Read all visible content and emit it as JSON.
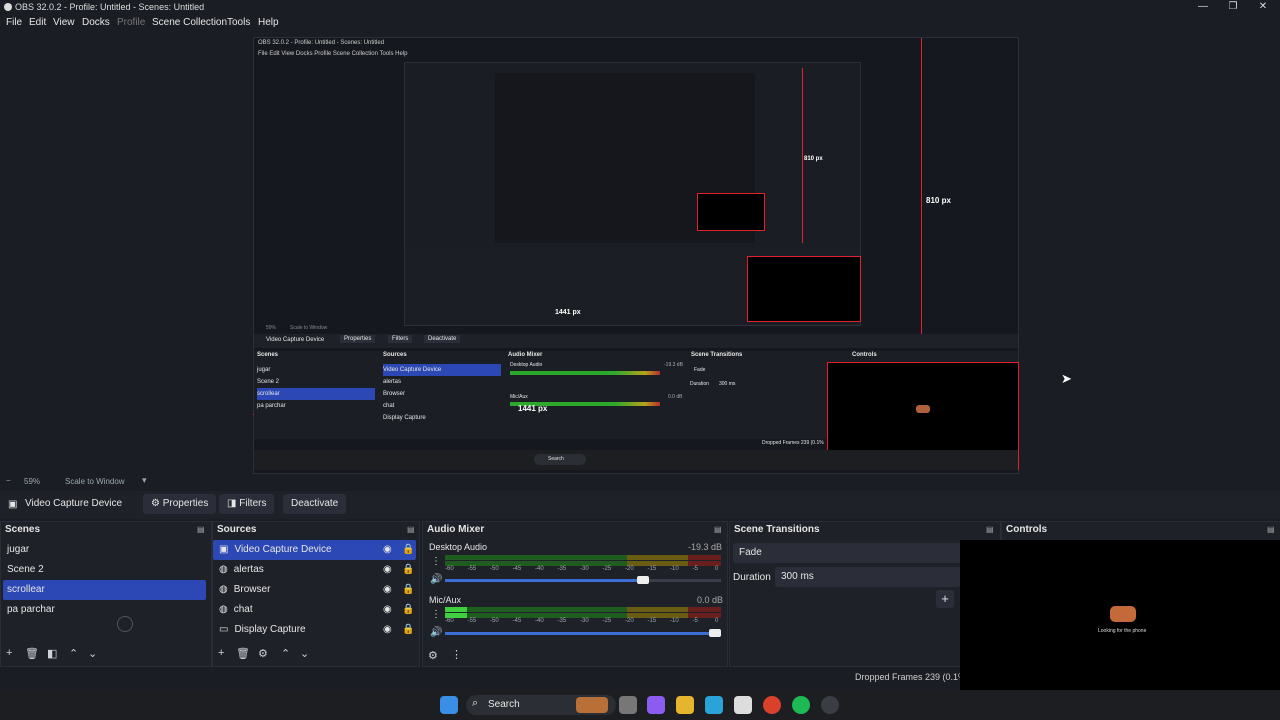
{
  "window": {
    "title": "OBS 32.0.2 - Profile: Untitled - Scenes: Untitled",
    "minimize": "—",
    "maximize": "❐",
    "close": "✕"
  },
  "menu": [
    "File",
    "Edit",
    "View",
    "Docks",
    "Profile",
    "Scene Collection",
    "Tools",
    "Help"
  ],
  "nested": {
    "title": "OBS 32.0.2 - Profile: Untitled - Scenes: Untitled",
    "menu": "File  Edit  View  Docks  Profile  Scene Collection  Tools  Help",
    "measure_810": "810 px",
    "measure_810_small": "810 px",
    "measure_1441": "1441 px",
    "zoom": "59%",
    "zoom_mode": "Scale to Window",
    "source_name": "Video Capture Device",
    "btn_properties": "Properties",
    "btn_filters": "Filters",
    "btn_deactivate": "Deactivate",
    "dock_scenes": "Scenes",
    "dock_sources": "Sources",
    "dock_mixer": "Audio Mixer",
    "dock_transitions": "Scene Transitions",
    "dock_controls": "Controls",
    "scenes": [
      "jugar",
      "Scene 2",
      "scrollear",
      "pa parchar"
    ],
    "sources": [
      "Video Capture Device",
      "alertas",
      "Browser",
      "chat",
      "Display Capture"
    ],
    "desktop_audio": "Desktop Audio",
    "desktop_db": "-19.3 dB",
    "mic": "Mic/Aux",
    "mic_db": "0.0 dB",
    "fade": "Fade",
    "duration": "Duration",
    "duration_val": "300 ms",
    "dropped": "Dropped Frames 239 (0.1%",
    "search": "Search"
  },
  "zoombar": {
    "minus": "−",
    "zoom": "59%",
    "mode": "Scale to Window"
  },
  "source_toolbar": {
    "source_name": "Video Capture Device",
    "properties": "Properties",
    "filters": "Filters",
    "deactivate": "Deactivate"
  },
  "scenes": {
    "title": "Scenes",
    "items": [
      "jugar",
      "Scene 2",
      "scrollear",
      "pa parchar"
    ],
    "selected": 2
  },
  "sources": {
    "title": "Sources",
    "items": [
      {
        "name": "Video Capture Device",
        "icon": "camera-icon"
      },
      {
        "name": "alertas",
        "icon": "globe-icon"
      },
      {
        "name": "Browser",
        "icon": "globe-icon"
      },
      {
        "name": "chat",
        "icon": "globe-icon"
      },
      {
        "name": "Display Capture",
        "icon": "monitor-icon"
      }
    ],
    "selected": 0
  },
  "mixer": {
    "title": "Audio Mixer",
    "tracks": [
      {
        "name": "Desktop Audio",
        "db": "-19.3 dB",
        "volume": 0.74
      },
      {
        "name": "Mic/Aux",
        "db": "0.0 dB",
        "volume": 1.0
      }
    ],
    "scale": [
      "-60",
      "-55",
      "-50",
      "-45",
      "-40",
      "-35",
      "-30",
      "-25",
      "-20",
      "-15",
      "-10",
      "-5",
      "0"
    ]
  },
  "transitions": {
    "title": "Scene Transitions",
    "transition": "Fade",
    "duration_label": "Duration",
    "duration": "300 ms",
    "add": "+"
  },
  "controls": {
    "title": "Controls",
    "overlay_text": "Looking for the phone"
  },
  "status": {
    "dropped": "Dropped Frames 239 (0.1%"
  },
  "taskbar": {
    "search": "Search"
  },
  "colors": {
    "accent": "#2c48b4",
    "guide": "#e0202b",
    "meter_green": "#2da82d",
    "meter_yellow": "#b8a21c",
    "meter_red": "#b52c2c"
  }
}
